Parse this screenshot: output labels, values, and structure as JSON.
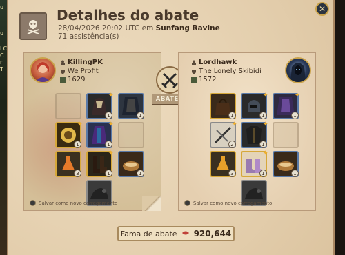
{
  "window": {
    "title": "Detalhes do abate",
    "timestamp": "28/04/2026 20:02 UTC",
    "location_prefix": "em",
    "location": "Sunfang Ravine",
    "assists": "71 assistência(s)"
  },
  "killer": {
    "name": "KillingPK",
    "guild": "We Profit",
    "ip": "1629",
    "save_note": "Salvar como novo carregamento"
  },
  "victim": {
    "name": "Lordhawk",
    "guild": "The Lonely Skibidi",
    "ip": "1572",
    "save_note": "Salvar como novo carregamento"
  },
  "kill_label": "ABATEU",
  "fame": {
    "label": "Fama de abate",
    "value": "920,644"
  },
  "left_strip": [
    "u",
    "u",
    "LC",
    "C",
    "r",
    "T"
  ],
  "colors": {
    "title": "#4a3a2c",
    "blood": "#c0433a",
    "gold": "#c9a24a"
  }
}
